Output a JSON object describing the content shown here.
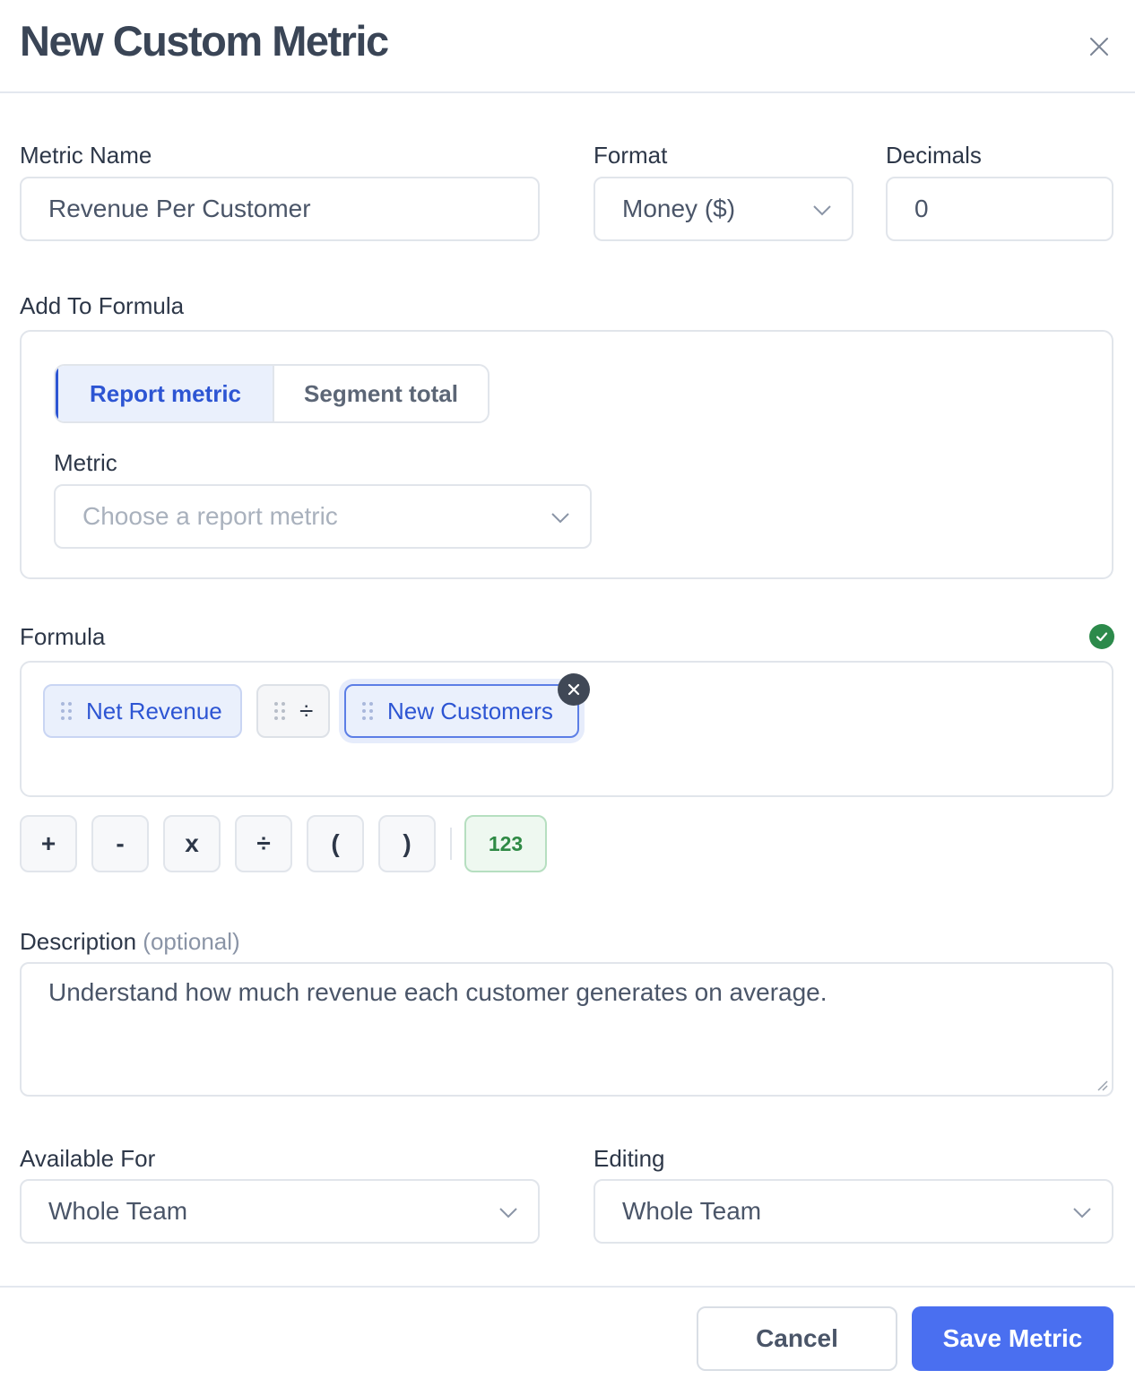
{
  "dialog": {
    "title": "New Custom Metric"
  },
  "metric_name": {
    "label": "Metric Name",
    "value": "Revenue Per Customer"
  },
  "format": {
    "label": "Format",
    "value": "Money ($)"
  },
  "decimals": {
    "label": "Decimals",
    "value": "0"
  },
  "add_to_formula": {
    "label": "Add To Formula",
    "tabs": [
      {
        "label": "Report metric",
        "active": true
      },
      {
        "label": "Segment total",
        "active": false
      }
    ],
    "metric_label": "Metric",
    "metric_placeholder": "Choose a report metric"
  },
  "formula": {
    "label": "Formula",
    "status_icon": "check-circle-icon",
    "tokens": [
      {
        "type": "metric",
        "label": "Net Revenue"
      },
      {
        "type": "operator",
        "label": "÷"
      },
      {
        "type": "metric",
        "label": "New Customers",
        "selected": true
      }
    ],
    "operators": [
      "+",
      "-",
      "x",
      "÷",
      "(",
      ")"
    ],
    "number_button": "123"
  },
  "description": {
    "label": "Description",
    "optional": "(optional)",
    "value": "Understand how much revenue each customer generates on average."
  },
  "available_for": {
    "label": "Available For",
    "value": "Whole Team"
  },
  "editing": {
    "label": "Editing",
    "value": "Whole Team"
  },
  "footer": {
    "cancel": "Cancel",
    "save": "Save Metric"
  },
  "colors": {
    "primary": "#4a6ff0",
    "accent_text": "#2d55d3",
    "success": "#2c8a4b"
  }
}
